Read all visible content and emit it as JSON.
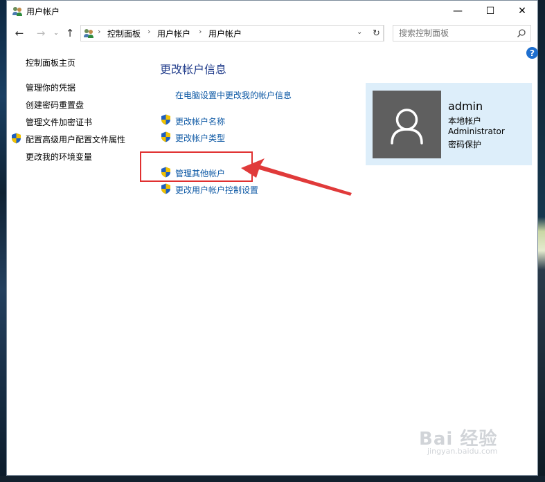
{
  "window": {
    "title": "用户帐户",
    "controls": {
      "minimize": "—",
      "maximize": "☐",
      "close": "✕"
    }
  },
  "addressbar": {
    "breadcrumbs": [
      "控制面板",
      "用户帐户",
      "用户帐户"
    ],
    "search_placeholder": "搜索控制面板"
  },
  "sidebar": {
    "items": [
      {
        "label": "控制面板主页",
        "shield": false
      },
      {
        "label": "管理你的凭据",
        "shield": false
      },
      {
        "label": "创建密码重置盘",
        "shield": false
      },
      {
        "label": "管理文件加密证书",
        "shield": false
      },
      {
        "label": "配置高级用户配置文件属性",
        "shield": true
      },
      {
        "label": "更改我的环境变量",
        "shield": false
      }
    ]
  },
  "main": {
    "title": "更改帐户信息",
    "links": [
      {
        "label": "在电脑设置中更改我的帐户信息",
        "shield": false
      },
      {
        "label": "更改帐户名称",
        "shield": true
      },
      {
        "label": "更改帐户类型",
        "shield": true
      },
      {
        "label": "管理其他帐户",
        "shield": true
      },
      {
        "label": "更改用户帐户控制设置",
        "shield": true
      }
    ]
  },
  "user": {
    "name": "admin",
    "account_type": "本地帐户",
    "group": "Administrator",
    "password_status": "密码保护"
  },
  "watermark": {
    "text": "Bai 经验",
    "url": "jingyan.baidu.com"
  },
  "colors": {
    "link": "#0b57a4",
    "title": "#1e3a8a",
    "highlight": "#e03030",
    "user_card_bg": "#ddeefa"
  }
}
